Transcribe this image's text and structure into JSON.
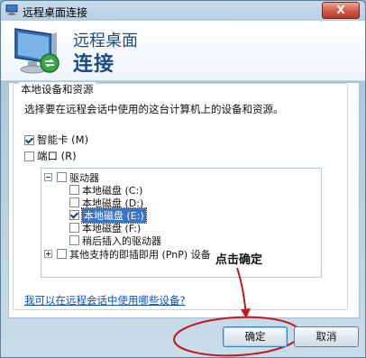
{
  "window": {
    "title": "远程桌面连接",
    "close_label": "X"
  },
  "header": {
    "line1": "远程桌面",
    "line2": "连接"
  },
  "group": {
    "legend": "本地设备和资源",
    "description": "选择要在远程会话中使用的这台计算机上的设备和资源。"
  },
  "options": [
    {
      "label": "智能卡 (M)",
      "checked": true
    },
    {
      "label": "端口 (R)",
      "checked": false
    }
  ],
  "tree": {
    "root_label": "驱动器",
    "drives": [
      {
        "label": "本地磁盘 (C:)",
        "checked": false,
        "selected": false
      },
      {
        "label": "本地磁盘 (D:)",
        "checked": false,
        "selected": false
      },
      {
        "label": "本地磁盘 (E:)",
        "checked": true,
        "selected": true
      },
      {
        "label": "本地磁盘 (F:)",
        "checked": false,
        "selected": false
      },
      {
        "label": "稍后插入的驱动器",
        "checked": false,
        "selected": false
      }
    ],
    "other_label": "其他支持的即插即用 (PnP) 设备"
  },
  "help_link": "我可以在远程会话中使用哪些设备?",
  "annotation": "点击确定",
  "buttons": {
    "ok": "确定",
    "cancel": "取消"
  }
}
